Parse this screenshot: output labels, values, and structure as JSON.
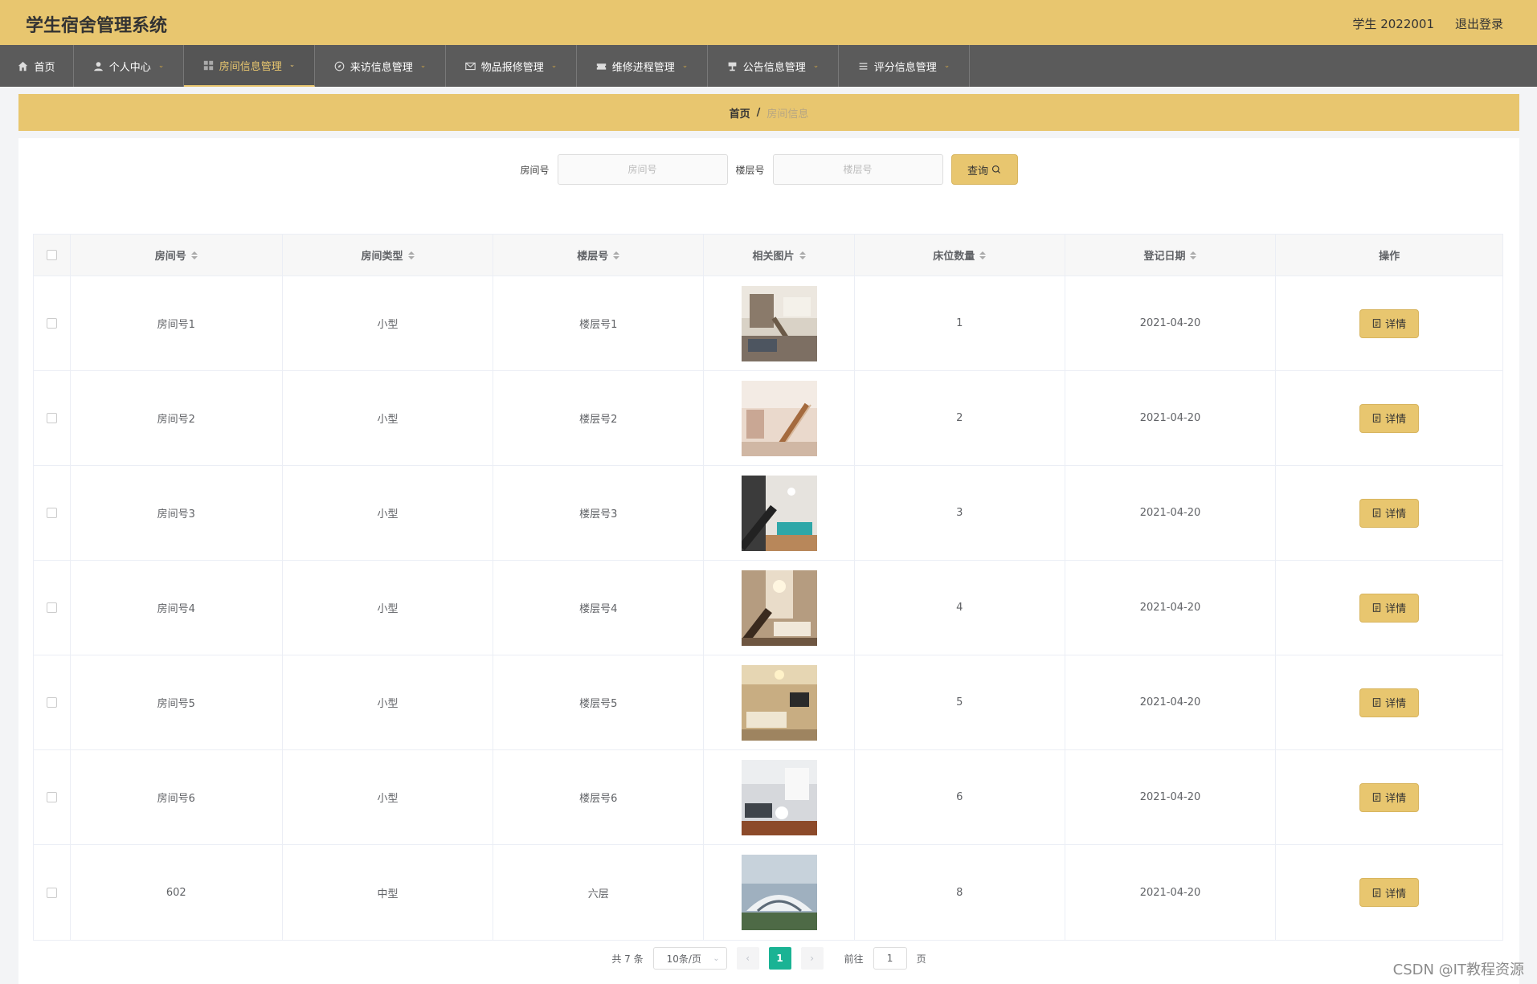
{
  "header": {
    "title": "学生宿舍管理系统",
    "user": "学生 2022001",
    "logout": "退出登录"
  },
  "nav": {
    "items": [
      {
        "label": "首页",
        "icon": "home-icon",
        "chevron": false,
        "active": false
      },
      {
        "label": "个人中心",
        "icon": "user-icon",
        "chevron": true,
        "active": false
      },
      {
        "label": "房间信息管理",
        "icon": "grid-icon",
        "chevron": true,
        "active": true
      },
      {
        "label": "来访信息管理",
        "icon": "compass-icon",
        "chevron": true,
        "active": false
      },
      {
        "label": "物品报修管理",
        "icon": "mail-icon",
        "chevron": true,
        "active": false
      },
      {
        "label": "维修进程管理",
        "icon": "ticket-icon",
        "chevron": true,
        "active": false
      },
      {
        "label": "公告信息管理",
        "icon": "cup-icon",
        "chevron": true,
        "active": false
      },
      {
        "label": "评分信息管理",
        "icon": "list-icon",
        "chevron": true,
        "active": false
      }
    ]
  },
  "breadcrumb": {
    "home": "首页",
    "separator": "/",
    "current": "房间信息"
  },
  "search": {
    "room_label": "房间号",
    "room_placeholder": "房间号",
    "floor_label": "楼层号",
    "floor_placeholder": "楼层号",
    "button": "查询"
  },
  "table": {
    "headers": [
      "房间号",
      "房间类型",
      "楼层号",
      "相关图片",
      "床位数量",
      "登记日期",
      "操作"
    ],
    "rows": [
      {
        "room": "房间号1",
        "type": "小型",
        "floor": "楼层号1",
        "beds": "1",
        "date": "2021-04-20",
        "action": "详情"
      },
      {
        "room": "房间号2",
        "type": "小型",
        "floor": "楼层号2",
        "beds": "2",
        "date": "2021-04-20",
        "action": "详情"
      },
      {
        "room": "房间号3",
        "type": "小型",
        "floor": "楼层号3",
        "beds": "3",
        "date": "2021-04-20",
        "action": "详情"
      },
      {
        "room": "房间号4",
        "type": "小型",
        "floor": "楼层号4",
        "beds": "4",
        "date": "2021-04-20",
        "action": "详情"
      },
      {
        "room": "房间号5",
        "type": "小型",
        "floor": "楼层号5",
        "beds": "5",
        "date": "2021-04-20",
        "action": "详情"
      },
      {
        "room": "房间号6",
        "type": "小型",
        "floor": "楼层号6",
        "beds": "6",
        "date": "2021-04-20",
        "action": "详情"
      },
      {
        "room": "602",
        "type": "中型",
        "floor": "六层",
        "beds": "8",
        "date": "2021-04-20",
        "action": "详情"
      }
    ]
  },
  "pagination": {
    "total": "共 7 条",
    "page_size": "10条/页",
    "current_page": "1",
    "goto_label": "前往",
    "goto_value": "1",
    "page_unit": "页"
  },
  "watermark": "CSDN @IT教程资源",
  "colors": {
    "accent": "#e8c66f",
    "nav_bg": "#5b5b5b",
    "page_active": "#1ab394"
  }
}
